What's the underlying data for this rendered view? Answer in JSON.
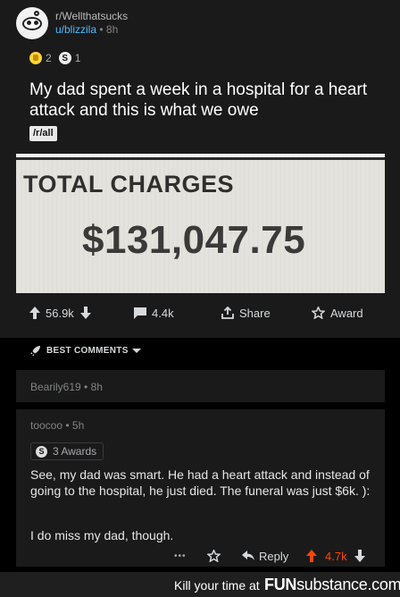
{
  "post": {
    "subreddit": "r/Wellthatsucks",
    "username": "u/blizzila",
    "age": " • 8h",
    "awards": {
      "gold_count": "2",
      "silver_glyph": "S",
      "silver_count": "1"
    },
    "title": "My dad spent a week in a hospital for a heart attack and this is what we owe",
    "flair": "/r/all",
    "media": {
      "label": "TOTAL CHARGES",
      "amount": "$131,047.75"
    },
    "actions": {
      "upvotes": "56.9k",
      "comments": "4.4k",
      "share": "Share",
      "award": "Award"
    }
  },
  "comments_header": {
    "label": "BEST COMMENTS"
  },
  "comments": [
    {
      "author": "Bearily619",
      "age": " • 8h"
    },
    {
      "author": "toocoo",
      "age": " • 5h",
      "awards_glyph": "S",
      "awards_label": "3 Awards",
      "body_paragraph_1": "See, my dad was smart. He had a heart attack and instead of going to the hospital, he just died. The funeral was just $6k. ):",
      "body_paragraph_2": "I do miss my dad, though.",
      "more": "•••",
      "reply": "Reply",
      "score": "4.7k"
    }
  ],
  "footer": {
    "tagline": "Kill your time at",
    "brand_fun": "FUN",
    "brand_sub": "substance",
    "brand_com": ".com"
  },
  "colors": {
    "upvote_orange": "#ff4500",
    "username_blue": "#4fbcff",
    "card_bg": "#1a1a1b"
  }
}
